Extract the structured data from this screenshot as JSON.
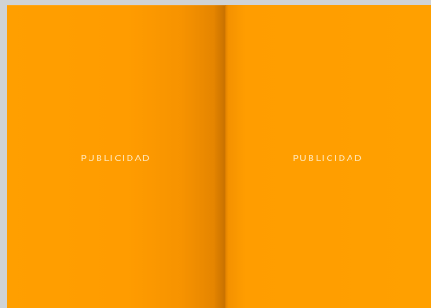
{
  "magazine": {
    "left_page": {
      "label": "PUBLICIDAD"
    },
    "right_page": {
      "label": "PUBLICIDAD"
    }
  },
  "colors": {
    "page_orange": "#ffa000",
    "background": "#cfd3d6"
  }
}
